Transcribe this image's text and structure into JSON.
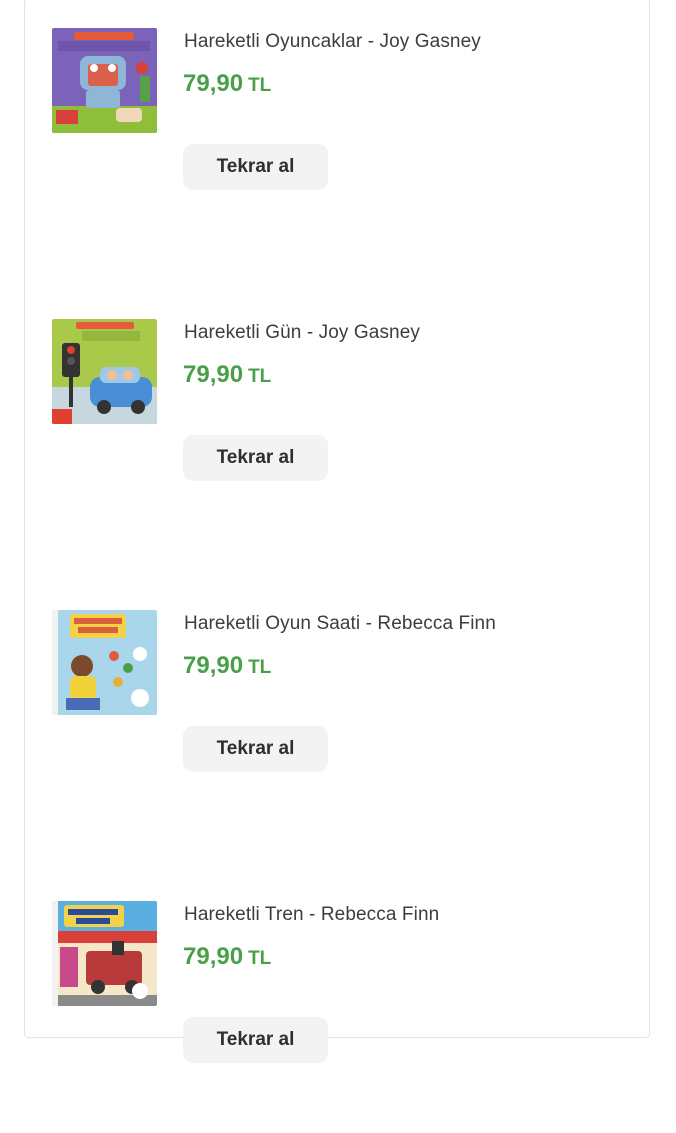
{
  "orders": [
    {
      "title": "Hareketli Oyuncaklar - Joy Gasney",
      "price": "79,90",
      "currency": "TL",
      "button_label": "Tekrar al",
      "cover_title": "Hareketli Oyuncaklar"
    },
    {
      "title": "Hareketli Gün - Joy Gasney",
      "price": "79,90",
      "currency": "TL",
      "button_label": "Tekrar al",
      "cover_title": "Hareketli Gün"
    },
    {
      "title": "Hareketli Oyun Saati - Rebecca Finn",
      "price": "79,90",
      "currency": "TL",
      "button_label": "Tekrar al",
      "cover_title": "Hareketli Oyun Saati"
    },
    {
      "title": "Hareketli Tren - Rebecca Finn",
      "price": "79,90",
      "currency": "TL",
      "button_label": "Tekrar al",
      "cover_title": "Hareketli Tren"
    }
  ],
  "colors": {
    "price": "#4a9f4a",
    "button_bg": "#f3f3f3",
    "title": "#3d3d3d"
  }
}
